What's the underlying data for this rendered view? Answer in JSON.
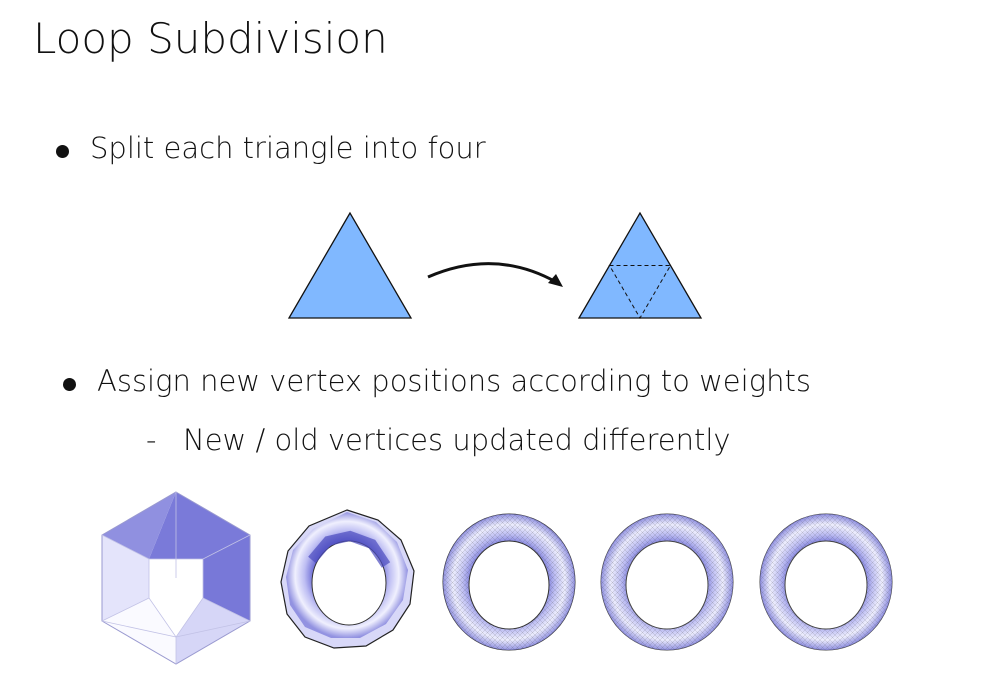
{
  "slide": {
    "title": "Loop Subdivision",
    "bullets": [
      {
        "text": "Split each triangle into four"
      },
      {
        "text": "Assign new vertex positions according to weights",
        "sub": [
          {
            "marker": "-",
            "text": "New / old vertices updated differently"
          }
        ]
      }
    ]
  },
  "colors": {
    "triangle_fill": "#80b8ff",
    "stroke": "#111111",
    "mesh_light": "#e6e6ff",
    "mesh_mid": "#a9a9f0",
    "mesh_dark": "#6f6fd8"
  },
  "figures": {
    "triangle_diagram": [
      "triangle-original",
      "arrow",
      "triangle-subdivided"
    ],
    "mesh_sequence": [
      "hexagon-mesh",
      "torus-level-1",
      "torus-level-2",
      "torus-level-3",
      "torus-level-4"
    ]
  }
}
